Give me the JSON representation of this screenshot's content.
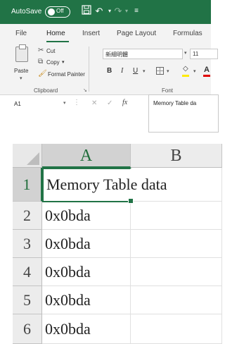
{
  "titlebar": {
    "autosave_label": "AutoSave",
    "autosave_state": "Off",
    "accent": "#217346"
  },
  "tabs": [
    {
      "label": "File"
    },
    {
      "label": "Home",
      "active": true
    },
    {
      "label": "Insert"
    },
    {
      "label": "Page Layout"
    },
    {
      "label": "Formulas"
    }
  ],
  "clipboard": {
    "paste": "Paste",
    "cut": "Cut",
    "copy": "Copy",
    "format_painter": "Format Painter",
    "group_label": "Clipboard"
  },
  "font": {
    "name": "新細明體",
    "size": "11",
    "bold": "B",
    "italic": "I",
    "underline": "U",
    "font_color_glyph": "A",
    "group_label": "Font",
    "fill_color": "#ffeb00",
    "font_color": "#e00000"
  },
  "formula_bar": {
    "name_box": "A1",
    "fx": "fx",
    "content": "Memory Table da"
  },
  "grid": {
    "columns": [
      "A",
      "B"
    ],
    "rows": [
      {
        "num": "1",
        "a": "Memory Table data"
      },
      {
        "num": "2",
        "a": "0x0bda"
      },
      {
        "num": "3",
        "a": "0x0bda"
      },
      {
        "num": "4",
        "a": "0x0bda"
      },
      {
        "num": "5",
        "a": "0x0bda"
      },
      {
        "num": "6",
        "a": "0x0bda"
      }
    ]
  }
}
